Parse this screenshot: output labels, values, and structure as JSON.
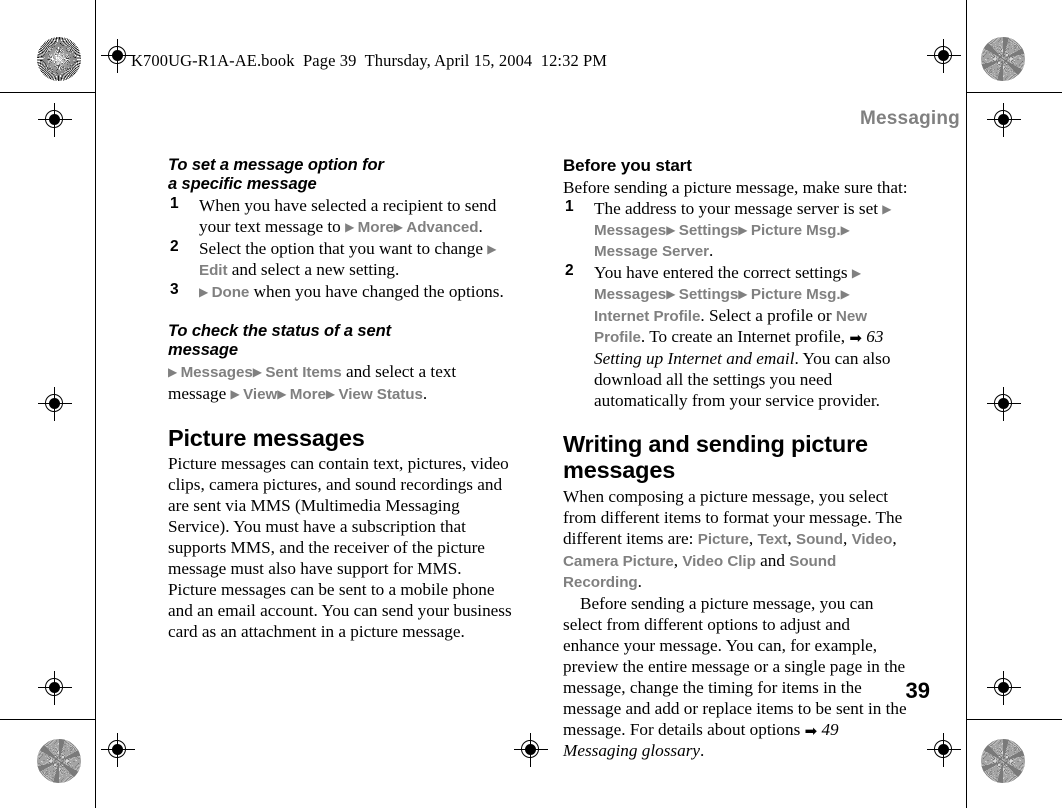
{
  "print_marks": {
    "file_banner": "K700UG-R1A-AE.book  Page 39  Thursday, April 15, 2004  12:32 PM",
    "registration_icon": "registration-crosshair",
    "rosette_icon": "color-rosette"
  },
  "header": {
    "running_head": "Messaging"
  },
  "footer": {
    "page_number": "39"
  },
  "colors": {
    "ui_term_gray": "#808080",
    "body_text": "#000000",
    "running_head_gray": "#808080"
  },
  "glyphs": {
    "ui_arrow": "▶",
    "xref_arrow": "➡"
  },
  "left_column": {
    "proc1": {
      "heading_line1": "To set a message option for",
      "heading_line2": "a specific message",
      "steps": [
        {
          "text_before": "When you have selected a recipient to send your text message to ",
          "segments": [
            {
              "type": "arrow"
            },
            {
              "type": "ui",
              "text": "More"
            },
            {
              "type": "arrow"
            },
            {
              "type": "ui",
              "text": "Advanced"
            }
          ],
          "text_after": "."
        },
        {
          "text_before": "Select the option that you want to change ",
          "segments": [
            {
              "type": "arrow"
            },
            {
              "type": "ui",
              "text": "Edit"
            }
          ],
          "text_after": " and select a new setting."
        },
        {
          "text_before": "",
          "segments": [
            {
              "type": "arrow"
            },
            {
              "type": "ui",
              "text": "Done"
            }
          ],
          "text_after": " when you have changed the options."
        }
      ]
    },
    "proc2": {
      "heading_line1": "To check the status of a sent",
      "heading_line2": "message",
      "body_segments": [
        {
          "type": "arrow"
        },
        {
          "type": "ui",
          "text": "Messages"
        },
        {
          "type": "arrow"
        },
        {
          "type": "ui",
          "text": "Sent Items"
        },
        {
          "type": "plain",
          "text": " and select a text message "
        },
        {
          "type": "arrow"
        },
        {
          "type": "ui",
          "text": "View"
        },
        {
          "type": "arrow"
        },
        {
          "type": "ui",
          "text": "More"
        },
        {
          "type": "arrow"
        },
        {
          "type": "ui",
          "text": "View Status"
        },
        {
          "type": "plain",
          "text": "."
        }
      ]
    },
    "section": {
      "heading": "Picture messages",
      "paragraph": "Picture messages can contain text, pictures, video clips, camera pictures, and sound recordings and are sent via MMS (Multimedia Messaging Service). You must have a subscription that supports MMS, and the receiver of the picture message must also have support for MMS. Picture messages can be sent to a mobile phone and an email account. You can send your business card as an attachment in a picture message."
    }
  },
  "right_column": {
    "before_you_start": {
      "heading": "Before you start",
      "intro": "Before sending a picture message, make sure that:",
      "steps": [
        {
          "text_before": "The address to your message server is set ",
          "segments": [
            {
              "type": "arrow"
            },
            {
              "type": "ui",
              "text": "Messages"
            },
            {
              "type": "arrow"
            },
            {
              "type": "ui",
              "text": "Settings"
            },
            {
              "type": "arrow"
            },
            {
              "type": "ui",
              "text": "Picture Msg."
            },
            {
              "type": "arrow"
            },
            {
              "type": "ui",
              "text": "Message Server"
            }
          ],
          "text_after": "."
        },
        {
          "text_before": "You have entered the correct settings ",
          "segments": [
            {
              "type": "arrow"
            },
            {
              "type": "ui",
              "text": "Messages"
            },
            {
              "type": "arrow"
            },
            {
              "type": "ui",
              "text": "Settings"
            },
            {
              "type": "arrow"
            },
            {
              "type": "ui",
              "text": "Picture Msg."
            },
            {
              "type": "arrow"
            },
            {
              "type": "ui",
              "text": "Internet Profile"
            },
            {
              "type": "plain",
              "text": ". Select a profile or "
            },
            {
              "type": "ui",
              "text": "New Profile"
            },
            {
              "type": "plain",
              "text": ". To create an Internet profile, "
            },
            {
              "type": "xref_arrow"
            },
            {
              "type": "xref",
              "text": " 63 Setting up Internet and email"
            },
            {
              "type": "plain",
              "text": ". You can also download all the settings you need automatically from your service provider."
            }
          ],
          "text_after": ""
        }
      ]
    },
    "writing_section": {
      "heading_line1": "Writing and sending picture",
      "heading_line2": "messages",
      "paragraph1_parts": [
        {
          "type": "plain",
          "text": "When composing a picture message, you select from different items to format your message. The different items are: "
        },
        {
          "type": "ui",
          "text": "Picture"
        },
        {
          "type": "plain",
          "text": ", "
        },
        {
          "type": "ui",
          "text": "Text"
        },
        {
          "type": "plain",
          "text": ", "
        },
        {
          "type": "ui",
          "text": "Sound"
        },
        {
          "type": "plain",
          "text": ", "
        },
        {
          "type": "ui",
          "text": "Video"
        },
        {
          "type": "plain",
          "text": ", "
        },
        {
          "type": "ui",
          "text": "Camera Picture"
        },
        {
          "type": "plain",
          "text": ", "
        },
        {
          "type": "ui",
          "text": "Video Clip"
        },
        {
          "type": "plain",
          "text": " and "
        },
        {
          "type": "ui",
          "text": "Sound Recording"
        },
        {
          "type": "plain",
          "text": "."
        }
      ],
      "paragraph2_parts": [
        {
          "type": "plain",
          "text": "Before sending a picture message, you can select from different options to adjust and enhance your message. You can, for example, preview the entire message or a single page in the message, change the timing for items in the message and add or replace items to be sent in the message. For details about options "
        },
        {
          "type": "xref_arrow"
        },
        {
          "type": "xref",
          "text": " 49 Messaging glossary"
        },
        {
          "type": "plain",
          "text": "."
        }
      ]
    }
  }
}
